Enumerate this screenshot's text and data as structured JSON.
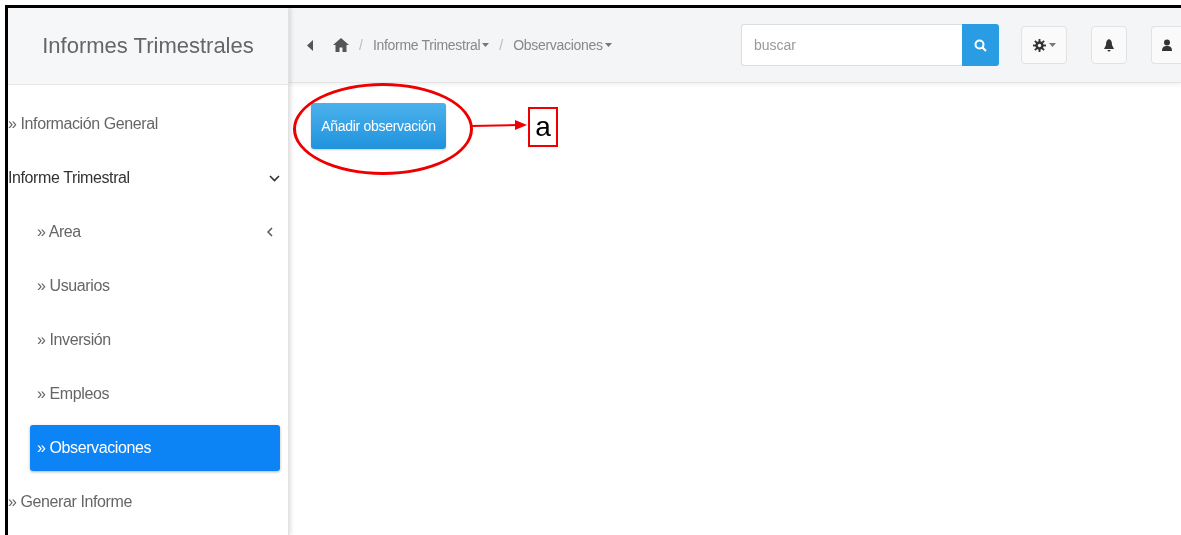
{
  "sidebar": {
    "title": "Informes Trimestrales",
    "items": [
      {
        "label": "» Información General",
        "selected": false
      },
      {
        "label": "Informe Trimestral",
        "selected": false,
        "expanded": true,
        "children": [
          {
            "label": "» Area",
            "selected": false,
            "expanded": false
          },
          {
            "label": "» Usuarios",
            "selected": false
          },
          {
            "label": "» Inversión",
            "selected": false
          },
          {
            "label": "» Empleos",
            "selected": false
          },
          {
            "label": "» Observaciones",
            "selected": true
          }
        ]
      },
      {
        "label": "» Generar Informe",
        "selected": false
      }
    ]
  },
  "breadcrumbs": [
    {
      "separator": "/",
      "label": "Informe Trimestral"
    },
    {
      "separator": "/",
      "label": "Observaciones"
    }
  ],
  "search": {
    "placeholder": "buscar"
  },
  "add_button": {
    "label": "Añadir observación"
  },
  "annotation": {
    "label": "a"
  }
}
